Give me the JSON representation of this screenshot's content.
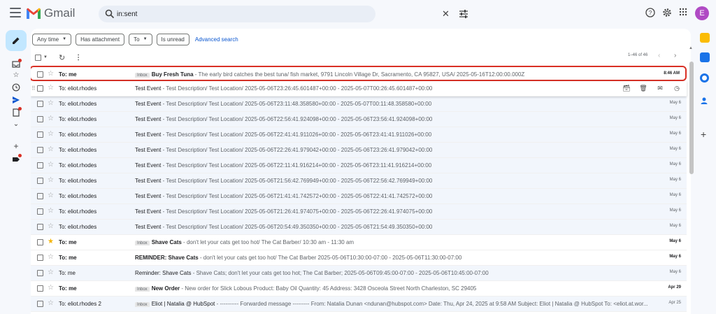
{
  "app": {
    "name": "Gmail",
    "avatar_initial": "E"
  },
  "search": {
    "value": "in:sent"
  },
  "filters": {
    "chips": [
      {
        "label": "Any time",
        "has_caret": true
      },
      {
        "label": "Has attachment",
        "has_caret": false
      },
      {
        "label": "To",
        "has_caret": true
      },
      {
        "label": "Is unread",
        "has_caret": false
      }
    ],
    "advanced_search": "Advanced search"
  },
  "pager": {
    "range": "1–46 of 46"
  },
  "colors": {
    "accent": "#0b57d0",
    "highlight_border": "#d93025",
    "avatar_bg": "#b04ac4",
    "compose_bg": "#c2e7ff"
  },
  "emails": [
    {
      "sender": "To: me",
      "badge": "Inbox",
      "subject": "Buy Fresh Tuna",
      "snippet": " - The early bird catches the best tuna/ fish market, 9791 Lincoln Village Dr, Sacramento, CA 95827, USA/ 2025-05-16T12:00:00.000Z",
      "date": "8:46 AM",
      "unread": true,
      "starred": false
    },
    {
      "sender": "To: eliot.rhodes",
      "badge": "",
      "subject": "Test Event",
      "snippet": " - Test Description/ Test Location/ 2025-05-06T23:26:45.601487+00:00 - 2025-05-07T00:26:45.601487+00:00",
      "date": "",
      "unread": false,
      "starred": false
    },
    {
      "sender": "To: eliot.rhodes",
      "badge": "",
      "subject": "Test Event",
      "snippet": " - Test Description/ Test Location/ 2025-05-06T23:11:48.358580+00:00 - 2025-05-07T00:11:48.358580+00:00",
      "date": "May 6",
      "unread": false,
      "starred": false
    },
    {
      "sender": "To: eliot.rhodes",
      "badge": "",
      "subject": "Test Event",
      "snippet": " - Test Description/ Test Location/ 2025-05-06T22:56:41.924098+00:00 - 2025-05-06T23:56:41.924098+00:00",
      "date": "May 6",
      "unread": false,
      "starred": false
    },
    {
      "sender": "To: eliot.rhodes",
      "badge": "",
      "subject": "Test Event",
      "snippet": " - Test Description/ Test Location/ 2025-05-06T22:41:41.911026+00:00 - 2025-05-06T23:41:41.911026+00:00",
      "date": "May 6",
      "unread": false,
      "starred": false
    },
    {
      "sender": "To: eliot.rhodes",
      "badge": "",
      "subject": "Test Event",
      "snippet": " - Test Description/ Test Location/ 2025-05-06T22:26:41.979042+00:00 - 2025-05-06T23:26:41.979042+00:00",
      "date": "May 6",
      "unread": false,
      "starred": false
    },
    {
      "sender": "To: eliot.rhodes",
      "badge": "",
      "subject": "Test Event",
      "snippet": " - Test Description/ Test Location/ 2025-05-06T22:11:41.916214+00:00 - 2025-05-06T23:11:41.916214+00:00",
      "date": "May 6",
      "unread": false,
      "starred": false
    },
    {
      "sender": "To: eliot.rhodes",
      "badge": "",
      "subject": "Test Event",
      "snippet": " - Test Description/ Test Location/ 2025-05-06T21:56:42.769949+00:00 - 2025-05-06T22:56:42.769949+00:00",
      "date": "May 6",
      "unread": false,
      "starred": false
    },
    {
      "sender": "To: eliot.rhodes",
      "badge": "",
      "subject": "Test Event",
      "snippet": " - Test Description/ Test Location/ 2025-05-06T21:41:41.742572+00:00 - 2025-05-06T22:41:41.742572+00:00",
      "date": "May 6",
      "unread": false,
      "starred": false
    },
    {
      "sender": "To: eliot.rhodes",
      "badge": "",
      "subject": "Test Event",
      "snippet": " - Test Description/ Test Location/ 2025-05-06T21:26:41.974075+00:00 - 2025-05-06T22:26:41.974075+00:00",
      "date": "May 6",
      "unread": false,
      "starred": false
    },
    {
      "sender": "To: eliot.rhodes",
      "badge": "",
      "subject": "Test Event",
      "snippet": " - Test Description/ Test Location/ 2025-05-06T20:54:49.350350+00:00 - 2025-05-06T21:54:49.350350+00:00",
      "date": "May 6",
      "unread": false,
      "starred": false
    },
    {
      "sender": "To: me",
      "badge": "Inbox",
      "subject": "Shave Cats",
      "snippet": " - don't let your cats get too hot/ The Cat Barber/ 10:30 am - 11:30 am",
      "date": "May 6",
      "unread": true,
      "starred": true
    },
    {
      "sender": "To: me",
      "badge": "",
      "subject": "REMINDER: Shave Cats",
      "snippet": " - don't let your cats get too hot/ The Cat Barber 2025-05-06T10:30:00-07:00 - 2025-05-06T11:30:00-07:00",
      "date": "May 6",
      "unread": true,
      "starred": false
    },
    {
      "sender": "To: me",
      "badge": "",
      "subject": "Reminder: Shave Cats",
      "snippet": " - Shave Cats; don't let your cats get too hot; The Cat Barber; 2025-05-06T09:45:00-07:00 - 2025-05-06T10:45:00-07:00",
      "date": "May 6",
      "unread": false,
      "starred": false
    },
    {
      "sender": "To: me",
      "badge": "Inbox",
      "subject": "New Order",
      "snippet": " - New order for Slick Lobous Product: Baby Oil Quantity: 45 Address: 3428 Osceola Street North Charleston, SC 29405",
      "date": "Apr 29",
      "unread": true,
      "starred": false
    },
    {
      "sender": "To: eliot.rhodes 2",
      "badge": "Inbox",
      "subject": "Eliot  | Natalia @ HubSpot",
      "snippet": " - ---------- Forwarded message --------- From: Natalia Dunan <ndunan@hubspot.com> Date: Thu, Apr 24, 2025 at 9:58 AM Subject: Eliot | Natalia @ HubSpot To: <eliot.at.wor...",
      "date": "Apr 25",
      "unread": false,
      "starred": false
    }
  ]
}
